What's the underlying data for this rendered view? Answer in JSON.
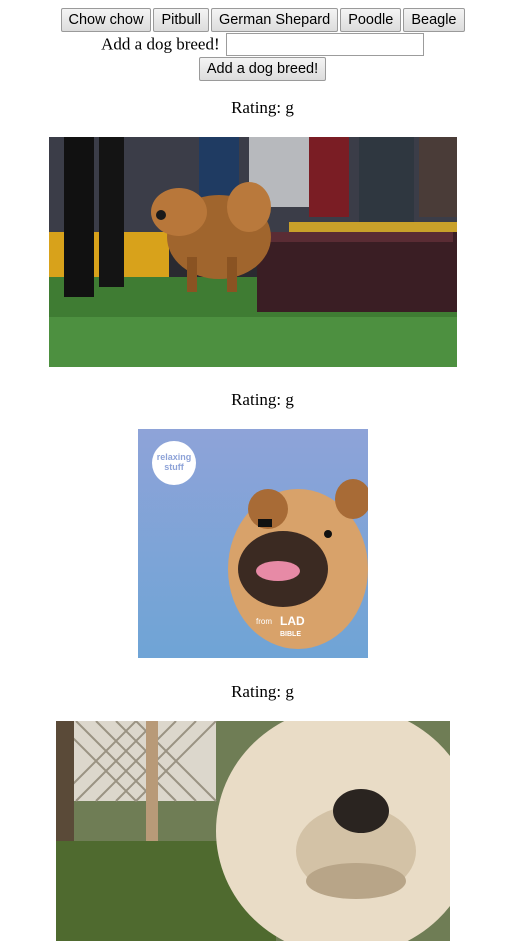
{
  "breed_buttons": [
    {
      "label": "Chow chow"
    },
    {
      "label": "Pitbull"
    },
    {
      "label": "German Shepard"
    },
    {
      "label": "Poodle"
    },
    {
      "label": "Beagle"
    }
  ],
  "form": {
    "label": "Add a dog breed!",
    "input_value": "",
    "submit_label": "Add a dog breed!"
  },
  "results": [
    {
      "rating_text": "Rating: g",
      "image_desc_icon": "chow-chow-dog-show-gif"
    },
    {
      "rating_text": "Rating: g",
      "image_desc_icon": "chow-chow-relaxing-stuff-gif",
      "overlay_text": "relaxing stuff",
      "watermark": "LAD BIBLE",
      "watermark_prefix": "from"
    },
    {
      "rating_text": "Rating: g",
      "image_desc_icon": "chow-chow-closeup-gif"
    }
  ]
}
